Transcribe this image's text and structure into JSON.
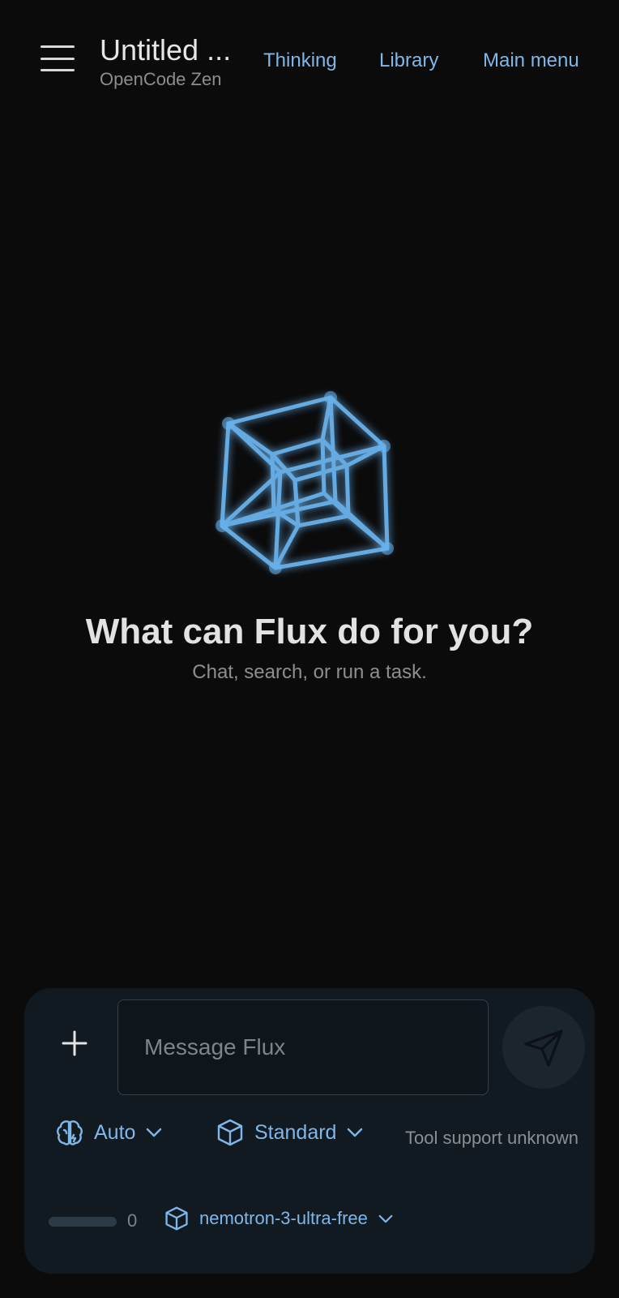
{
  "header": {
    "title": "Untitled ...",
    "subtitle": "OpenCode Zen",
    "nav": {
      "thinking": "Thinking",
      "library": "Library",
      "main_menu": "Main menu"
    }
  },
  "hero": {
    "title": "What can Flux do for you?",
    "subtitle": "Chat, search, or run a task."
  },
  "composer": {
    "placeholder": "Message Flux",
    "value": "",
    "reasoning_mode": "Auto",
    "response_mode": "Standard",
    "tool_status": "Tool support unknown",
    "usage_count": "0",
    "usage_fraction": 0,
    "model": "nemotron-3-ultra-free"
  },
  "icons": {
    "menu": "hamburger-icon",
    "hero": "tesseract-icon",
    "add": "plus-icon",
    "send": "send-icon",
    "reasoning": "brain-icon",
    "response": "cube-icon",
    "model": "cube-icon",
    "dropdown": "chevron-down-icon"
  },
  "colors": {
    "background": "#0b0b0c",
    "accent": "#7fb7e8",
    "panel": "#111a21"
  }
}
